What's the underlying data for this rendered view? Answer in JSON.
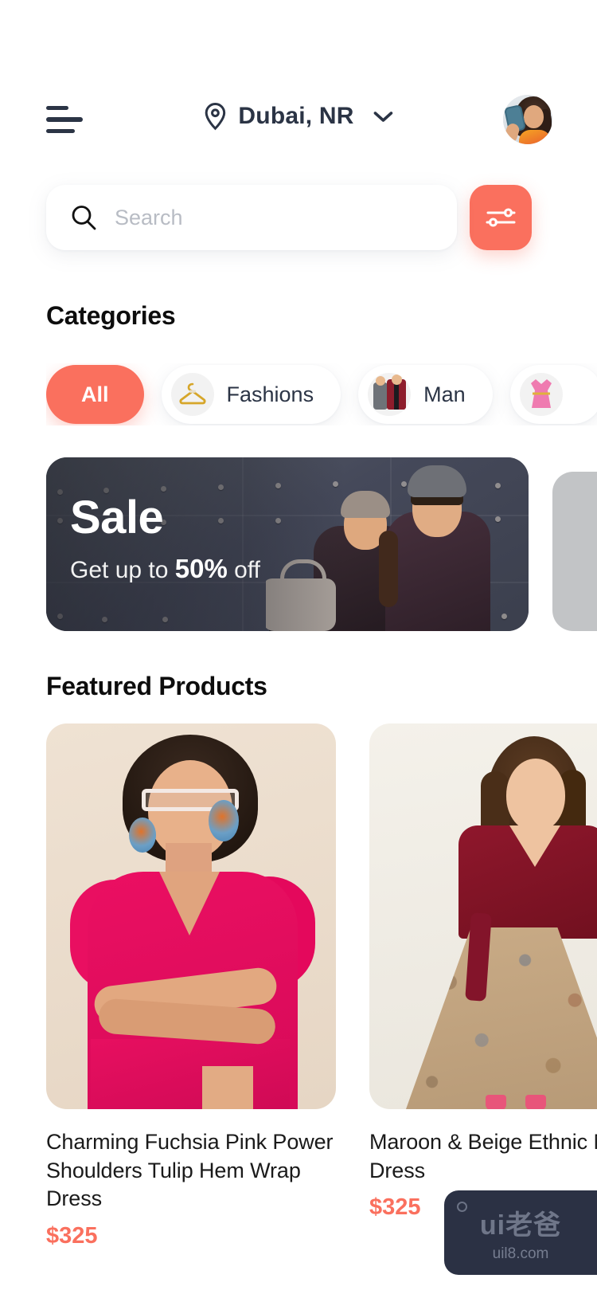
{
  "header": {
    "menu_icon": "hamburger-menu-icon",
    "location_icon": "location-pin-icon",
    "location_label": "Dubai, NR",
    "chevron_icon": "chevron-down-icon",
    "avatar_alt": "user-avatar-photo"
  },
  "search": {
    "icon": "search-icon",
    "placeholder": "Search",
    "value": "",
    "filter_icon": "filter-sliders-icon"
  },
  "categories": {
    "title": "Categories",
    "items": [
      {
        "label": "All",
        "icon": "",
        "active": true
      },
      {
        "label": "Fashions",
        "icon": "clothes-hanger-icon",
        "active": false
      },
      {
        "label": "Man",
        "icon": "man-suit-icon",
        "active": false
      },
      {
        "label": "",
        "icon": "pink-dress-icon",
        "active": false
      }
    ]
  },
  "banner": {
    "title": "Sale",
    "subtitle_prefix": "Get up to ",
    "subtitle_highlight": "50%",
    "subtitle_suffix": " off",
    "image_alt": "couple-on-metal-wall-photo"
  },
  "featured": {
    "title": "Featured Products",
    "products": [
      {
        "title": "Charming Fuchsia Pink Power Shoulders Tulip Hem Wrap Dress",
        "price": "$325",
        "image_alt": "woman-in-fuchsia-pink-dress"
      },
      {
        "title": "Maroon & Beige Ethnic Maxi Dress",
        "price": "$325",
        "image_alt": "woman-in-maroon-beige-maxi-dress"
      }
    ]
  },
  "watermark": {
    "main": "ui老爸",
    "sub": "uil8.com"
  },
  "colors": {
    "accent": "#FA705E",
    "text_dark": "#2B3445",
    "price": "#FA705E",
    "background": "#FFFFFF"
  }
}
